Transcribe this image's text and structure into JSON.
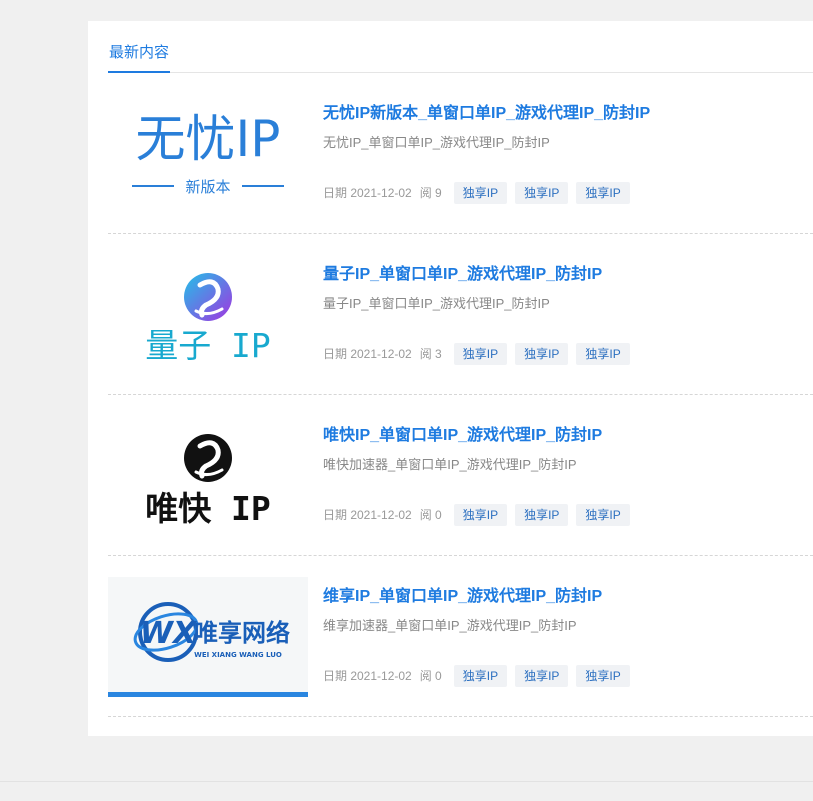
{
  "section": {
    "tab_label": "最新内容"
  },
  "colors": {
    "accent": "#1e7be0",
    "tag_bg": "#f0f2f5"
  },
  "articles": [
    {
      "title": "无忧IP新版本_单窗口单IP_游戏代理IP_防封IP",
      "description": "无忧IP_单窗口单IP_游戏代理IP_防封IP",
      "date": "日期 2021-12-02",
      "views": "阅 9",
      "tags": [
        "独享IP",
        "独享IP",
        "独享IP"
      ],
      "thumb": {
        "brand": "无忧IP",
        "subtitle": "新版本"
      }
    },
    {
      "title": "量子IP_单窗口单IP_游戏代理IP_防封IP",
      "description": "量子IP_单窗口单IP_游戏代理IP_防封IP",
      "date": "日期 2021-12-02",
      "views": "阅 3",
      "tags": [
        "独享IP",
        "独享IP",
        "独享IP"
      ],
      "thumb": {
        "brand": "量子 IP"
      }
    },
    {
      "title": "唯快IP_单窗口单IP_游戏代理IP_防封IP",
      "description": "唯快加速器_单窗口单IP_游戏代理IP_防封IP",
      "date": "日期 2021-12-02",
      "views": "阅 0",
      "tags": [
        "独享IP",
        "独享IP",
        "独享IP"
      ],
      "thumb": {
        "brand": "唯快 IP"
      }
    },
    {
      "title": "维享IP_单窗口单IP_游戏代理IP_防封IP",
      "description": "维享加速器_单窗口单IP_游戏代理IP_防封IP",
      "date": "日期 2021-12-02",
      "views": "阅 0",
      "tags": [
        "独享IP",
        "独享IP",
        "独享IP"
      ],
      "thumb": {
        "mark": "WX",
        "brand": "唯享网络",
        "subtitle": "WEI XIANG WANG LUO"
      }
    }
  ]
}
